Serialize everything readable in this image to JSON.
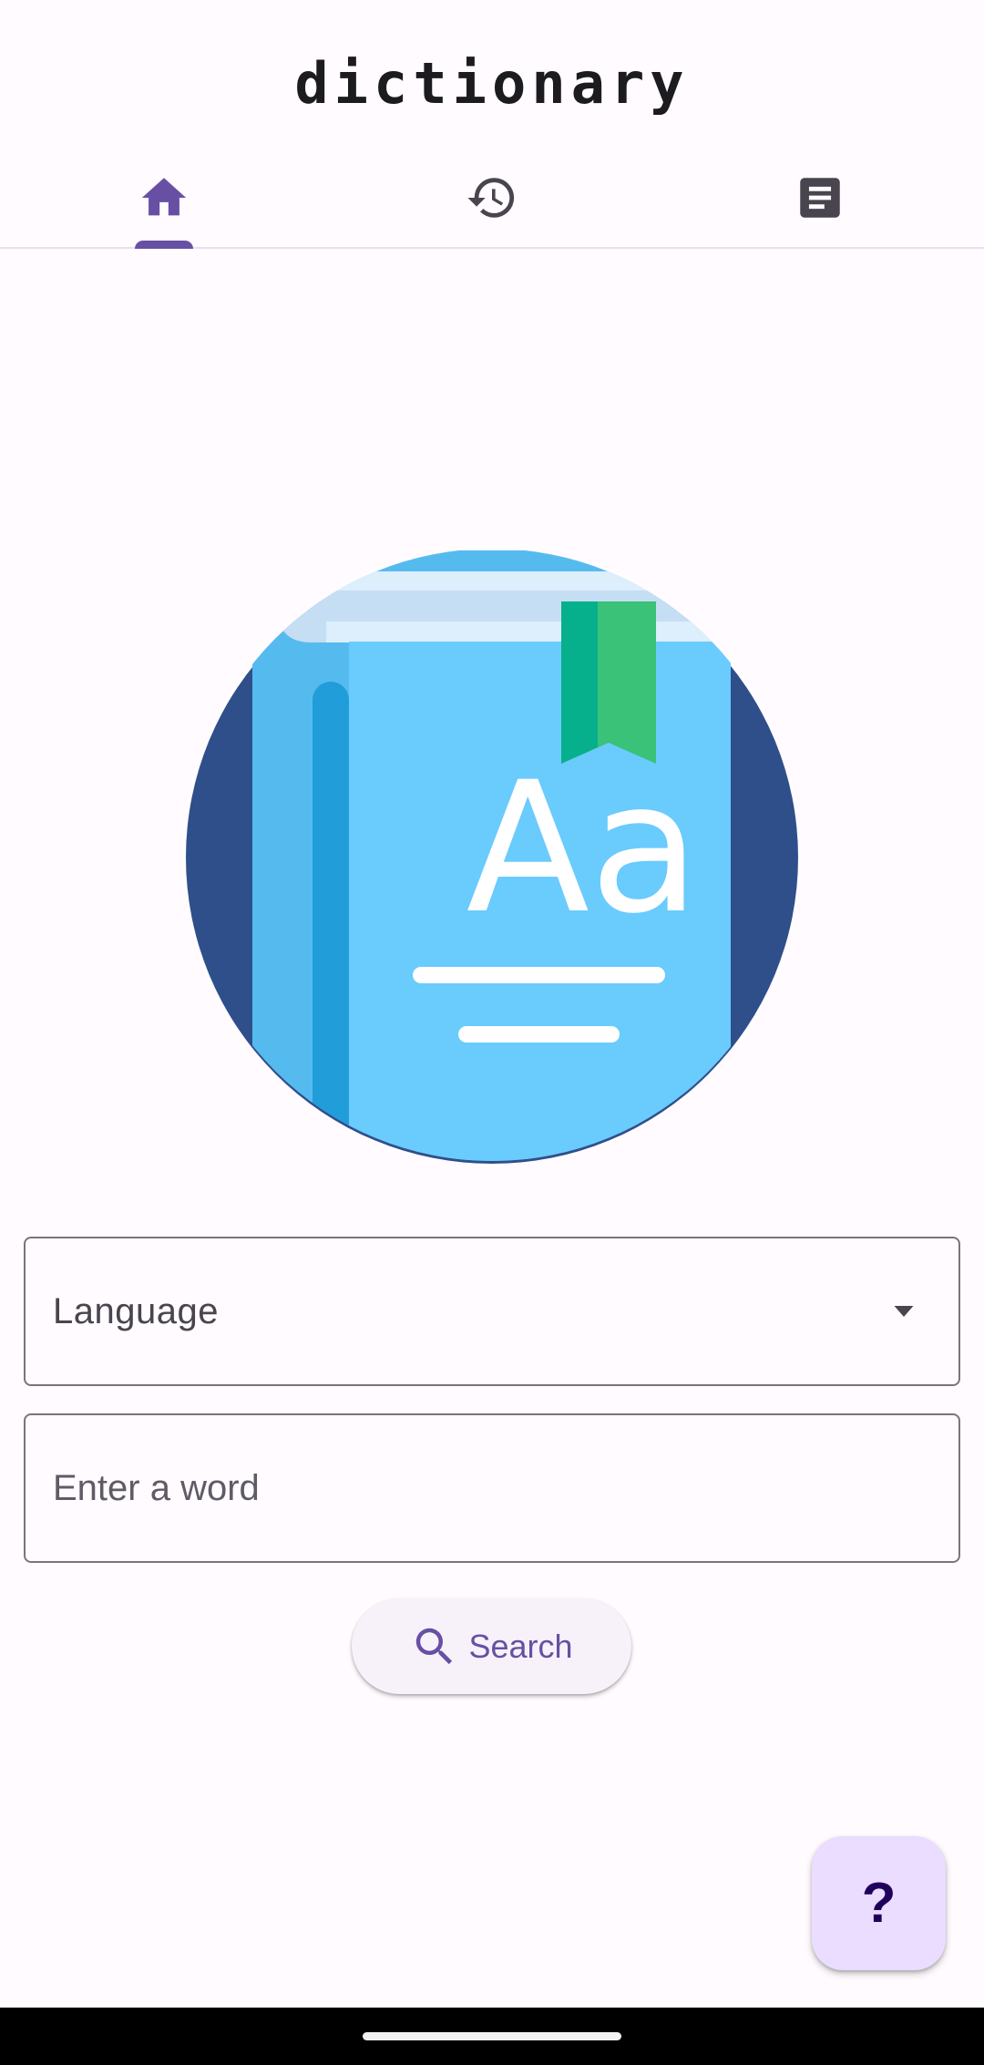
{
  "app": {
    "title": "dictionary"
  },
  "tabs": [
    {
      "icon": "home-icon",
      "selected": true
    },
    {
      "icon": "history-icon",
      "selected": false
    },
    {
      "icon": "article-icon",
      "selected": false
    }
  ],
  "hero": {
    "icon": "dictionary-book-icon",
    "cover_letters": "Aa"
  },
  "form": {
    "language_label": "Language",
    "word_placeholder": "Enter a word",
    "word_value": "",
    "search_label": "Search"
  },
  "fab": {
    "label": "?"
  },
  "colors": {
    "accent": "#6750a4",
    "background": "#fffbfe",
    "icon_inactive": "#49454f",
    "fab_background": "#eaddff",
    "book_circle": "#2f4f8b",
    "book_cover": "#6acbfd",
    "bookmark": "#39c278"
  }
}
